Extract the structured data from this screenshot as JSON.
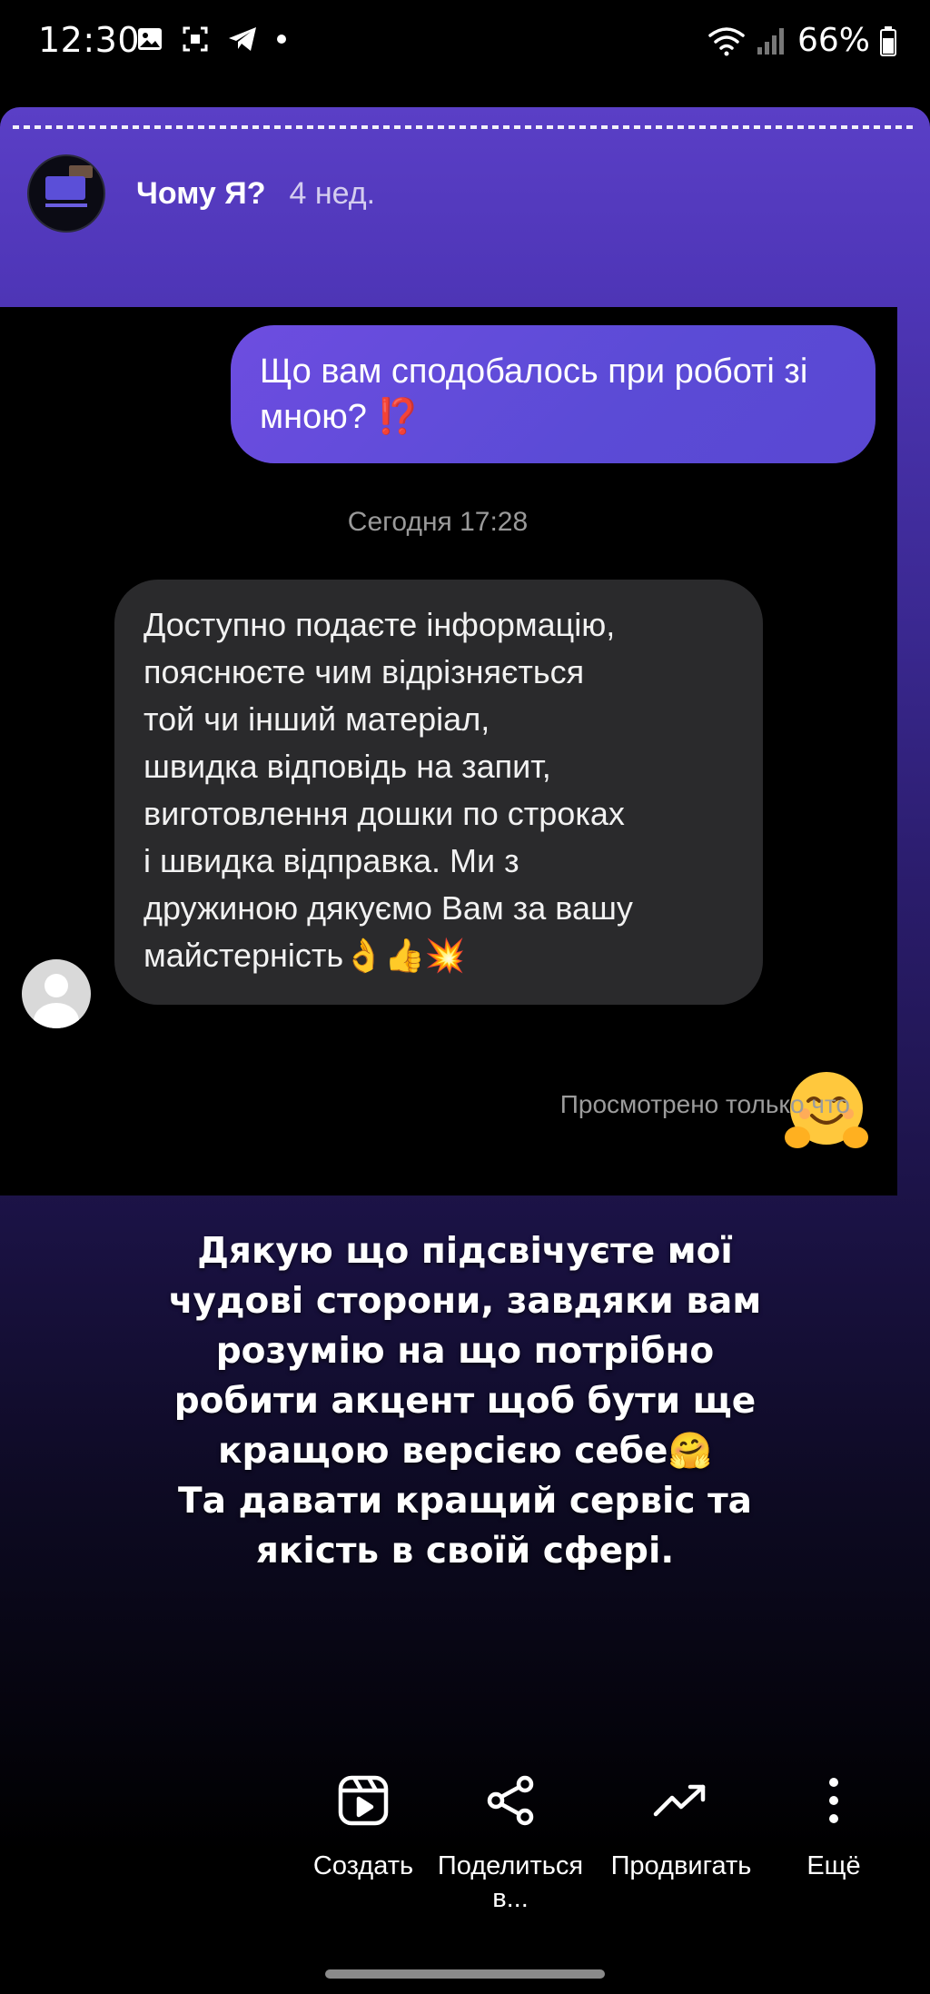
{
  "status_bar": {
    "time": "12:30",
    "battery": "66%",
    "left_icons": [
      "image-icon",
      "screenshot-icon",
      "telegram-icon",
      "dot-icon"
    ],
    "right_icons": [
      "wifi-icon",
      "signal-icon",
      "battery-icon"
    ]
  },
  "story": {
    "author": "Чому Я?",
    "posted": "4 нед.",
    "progress": 1.0
  },
  "chat": {
    "outgoing_message": "Що вам сподобалось при роботі зі мною?",
    "outgoing_emoji": "⁉️",
    "date_separator": "Сегодня 17:28",
    "incoming_message": "Доступно подаєте інформацію,\nпояснюєте чим відрізняється\nтой чи інший матеріал,\nшвидка відповідь на запит,\nвиготовлення дошки по строках\nі швидка відправка. Ми з\nдружиною дякуємо Вам за вашу\nмайстерність👌👍💥",
    "reaction_emoji": "🤗",
    "seen_status": "Просмотрено только что"
  },
  "caption": {
    "text": "Дякую що підсвічуєте мої\nчудові сторони, завдяки вам\nрозумію на що потрібно\nробити акцент щоб бути ще\nкращою версією себе🤗\nТа давати кращий сервіс та\nякість в своїй сфері."
  },
  "actions": {
    "create": "Создать",
    "share": "Поделиться\nв...",
    "promote": "Продвигать",
    "more": "Ещё"
  },
  "colors": {
    "outgoing_bubble": "#5b4bd6",
    "incoming_bubble": "#2a2a2c",
    "story_top": "#5a3fc6"
  }
}
